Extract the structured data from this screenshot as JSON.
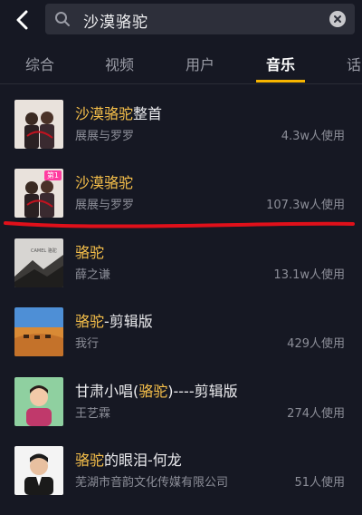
{
  "search": {
    "query": "沙漠骆驼"
  },
  "tabs": [
    {
      "label": "综合"
    },
    {
      "label": "视频"
    },
    {
      "label": "用户"
    },
    {
      "label": "音乐"
    },
    {
      "label": "话"
    }
  ],
  "active_tab": "音乐",
  "results": [
    {
      "title_hl": "沙漠骆驼",
      "title_rest": "整首",
      "artist": "展展与罗罗",
      "usage": "4.3w人使用"
    },
    {
      "title_hl": "沙漠骆驼",
      "title_rest": "",
      "artist": "展展与罗罗",
      "usage": "107.3w人使用",
      "badge": "第1"
    },
    {
      "title_hl": "骆驼",
      "title_rest": "",
      "artist": "薛之谦",
      "usage": "13.1w人使用",
      "cover_text": "CAMEL 骆驼"
    },
    {
      "title_hl": "骆驼",
      "title_rest": "-剪辑版",
      "artist": "我行",
      "usage": "429人使用"
    },
    {
      "title_pre": "甘肃小唱(",
      "title_hl": "骆驼",
      "title_rest": ")----剪辑版",
      "artist": "王艺霖",
      "usage": "274人使用"
    },
    {
      "title_hl": "骆驼",
      "title_rest": "的眼泪-何龙",
      "artist": "芜湖市音韵文化传媒有限公司",
      "usage": "51人使用"
    }
  ],
  "colors": {
    "background": "#161823",
    "accent": "#f7b500",
    "highlight": "#f7c04a",
    "annotation": "#e0101a"
  }
}
